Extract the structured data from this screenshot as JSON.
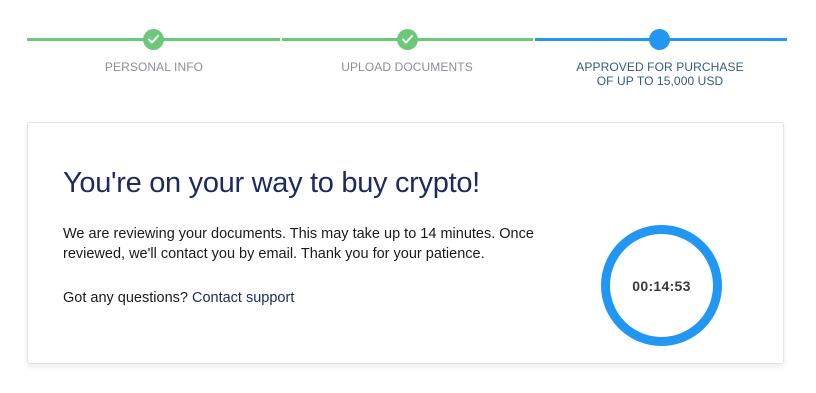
{
  "colors": {
    "done": "#6cc879",
    "active": "#2196f3",
    "headline": "#1d2a5e",
    "link": "#1d2a5e"
  },
  "stepper": {
    "steps": [
      {
        "label": "PERSONAL INFO",
        "state": "completed",
        "icon": "check-icon"
      },
      {
        "label": "UPLOAD DOCUMENTS",
        "state": "completed",
        "icon": "check-icon"
      },
      {
        "label": "APPROVED FOR PURCHASE OF UP TO 15,000 USD",
        "label_line1": "APPROVED FOR PURCHASE",
        "label_line2": "OF UP TO 15,000 USD",
        "state": "active",
        "icon": "dot-icon"
      }
    ]
  },
  "card": {
    "title": "You're on your way to buy crypto!",
    "message": "We are reviewing your documents. This may take up to 14 minutes. Once reviewed, we'll contact you by email. Thank you for your patience.",
    "questions_prefix": "Got any questions? ",
    "contact_link": "Contact support",
    "timer": "00:14:53"
  }
}
